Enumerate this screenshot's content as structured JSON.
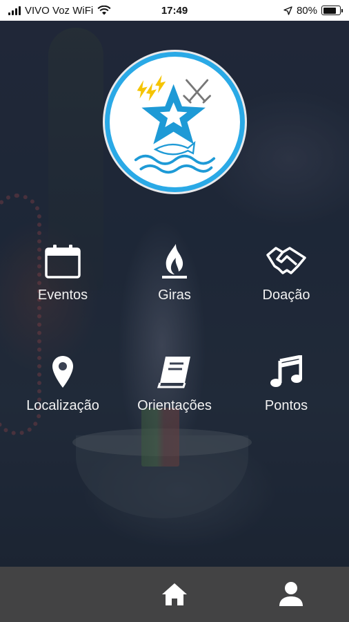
{
  "status_bar": {
    "carrier": "VIVO Voz WiFi",
    "time": "17:49",
    "battery_percent": "80%",
    "battery_level": 0.8
  },
  "logo": {
    "icons": [
      "lightning-bolts",
      "crossed-swords",
      "star",
      "sea-waves",
      "fish"
    ]
  },
  "menu": [
    {
      "label": "Eventos",
      "icon": "calendar-icon"
    },
    {
      "label": "Giras",
      "icon": "flame-icon"
    },
    {
      "label": "Doação",
      "icon": "handshake-icon"
    },
    {
      "label": "Localização",
      "icon": "location-pin-icon"
    },
    {
      "label": "Orientações",
      "icon": "book-icon"
    },
    {
      "label": "Pontos",
      "icon": "music-note-icon"
    }
  ],
  "tab_bar": {
    "tabs": [
      {
        "icon": "home-icon"
      },
      {
        "icon": "profile-icon"
      }
    ]
  },
  "colors": {
    "logo_ring": "#2aa9e6",
    "tab_bar": "#434344",
    "menu_text": "#f2f2f2"
  }
}
